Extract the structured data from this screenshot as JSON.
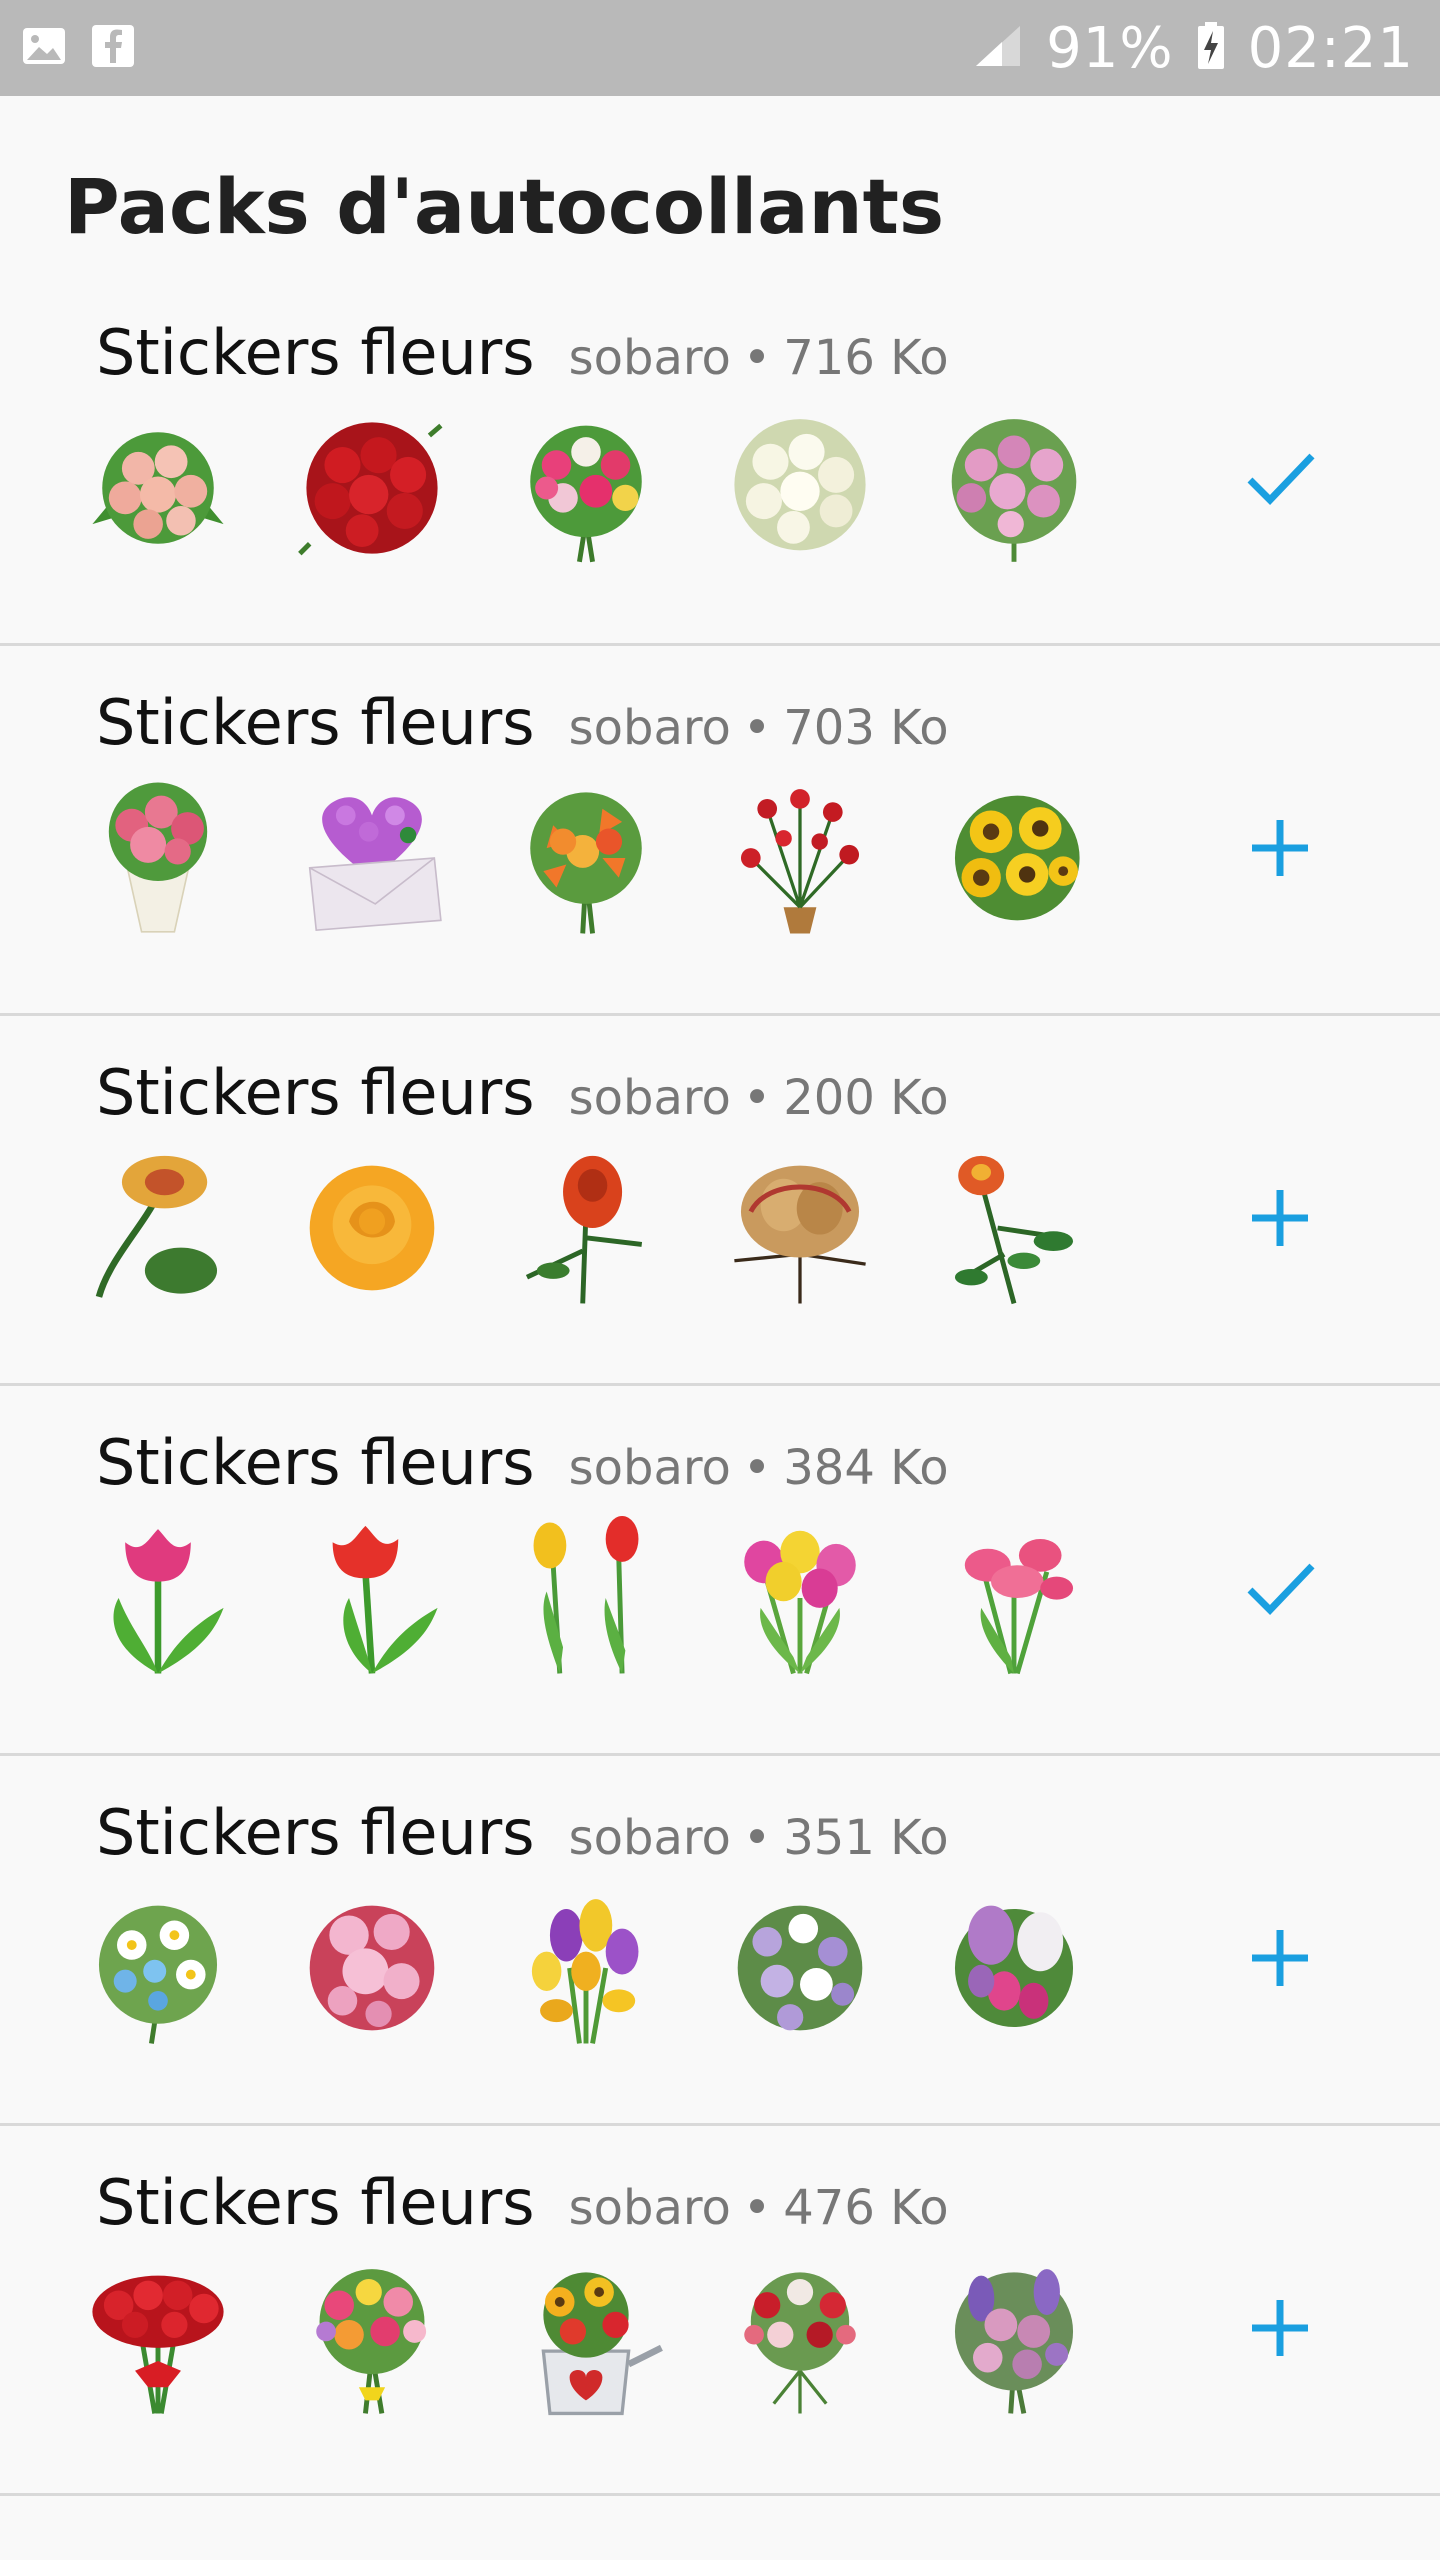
{
  "status_bar": {
    "battery": "91%",
    "time": "02:21",
    "icons": [
      "gallery-notification-icon",
      "facebook-notification-icon",
      "signal-icon",
      "battery-charging-icon"
    ]
  },
  "page_title": "Packs d'autocollants",
  "accent_color": "#1a9fe0",
  "packs": [
    {
      "name": "Stickers fleurs",
      "author": "sobaro",
      "size": "716 Ko",
      "status": "added",
      "stickers": [
        "rose-bouquet",
        "red-roses",
        "mixed-bouquet",
        "white-roses",
        "pink-bouquet"
      ]
    },
    {
      "name": "Stickers fleurs",
      "author": "sobaro",
      "size": "703 Ko",
      "status": "add",
      "stickers": [
        "roses-vase",
        "heart-envelope",
        "lily-bouquet",
        "red-roses-vase",
        "sunflowers"
      ]
    },
    {
      "name": "Stickers fleurs",
      "author": "sobaro",
      "size": "200 Ko",
      "status": "add",
      "stickers": [
        "yellow-rose",
        "orange-rose",
        "red-rose-stem",
        "wilted-rose",
        "rose-branch"
      ]
    },
    {
      "name": "Stickers fleurs",
      "author": "sobaro",
      "size": "384 Ko",
      "status": "added",
      "stickers": [
        "pink-tulip",
        "red-tulip",
        "two-tulips",
        "tulip-bouquet",
        "pink-tulips"
      ]
    },
    {
      "name": "Stickers fleurs",
      "author": "sobaro",
      "size": "351 Ko",
      "status": "add",
      "stickers": [
        "daisy-bouquet",
        "pink-roses",
        "crocus-bouquet",
        "violet-bouquet",
        "lilac-bouquet"
      ]
    },
    {
      "name": "Stickers fleurs",
      "author": "sobaro",
      "size": "476 Ko",
      "status": "add",
      "stickers": [
        "red-rose-bundle",
        "carnation-bouquet",
        "watering-can",
        "small-bouquet",
        "purple-bouquet"
      ]
    }
  ]
}
